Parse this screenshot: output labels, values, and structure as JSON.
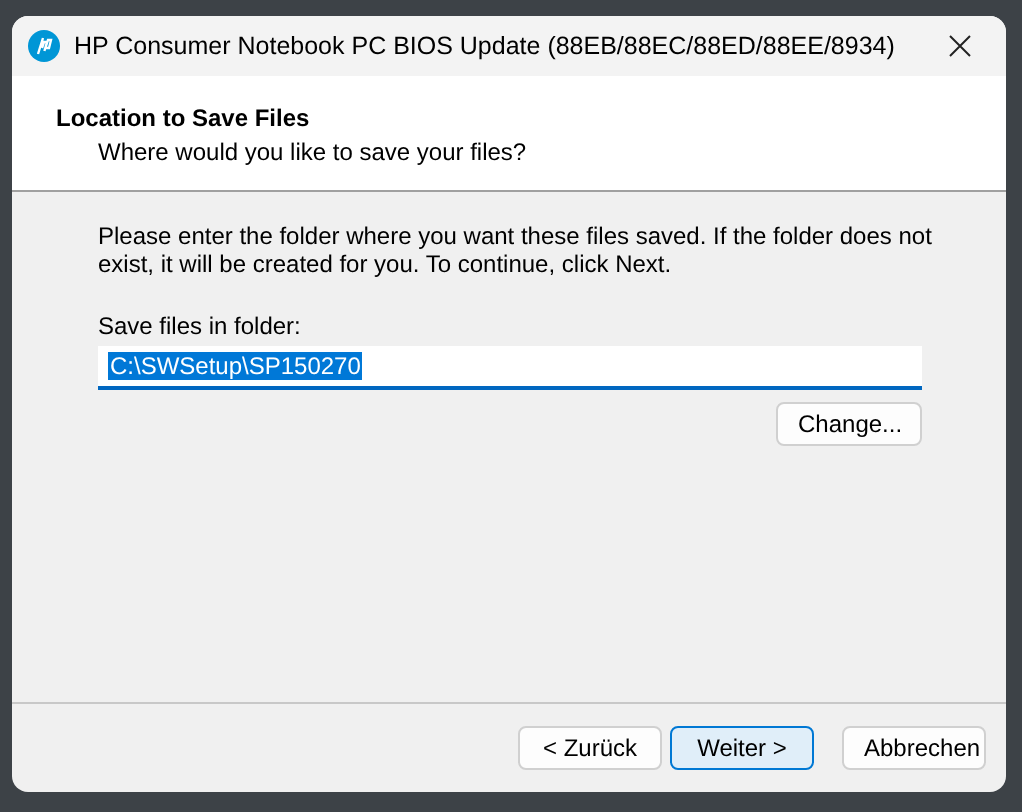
{
  "window": {
    "title": "HP Consumer Notebook PC BIOS Update (88EB/88EC/88ED/88EE/8934)"
  },
  "header": {
    "title": "Location to Save Files",
    "subtitle": "Where would you like to save your files?"
  },
  "body": {
    "instructions": "Please enter the folder where you want these files saved.  If the folder does not exist, it will be created for you.  To continue, click Next.",
    "folder_label": "Save files in folder:",
    "folder_field": {
      "value": "C:\\SWSetup\\SP150270",
      "text_selected": true
    },
    "change_button": "Change..."
  },
  "buttons": [
    {
      "label": "< Zurück",
      "default": false
    },
    {
      "label": "Weiter >",
      "default": true
    },
    {
      "label": "Abbrechen",
      "default": false
    }
  ]
}
